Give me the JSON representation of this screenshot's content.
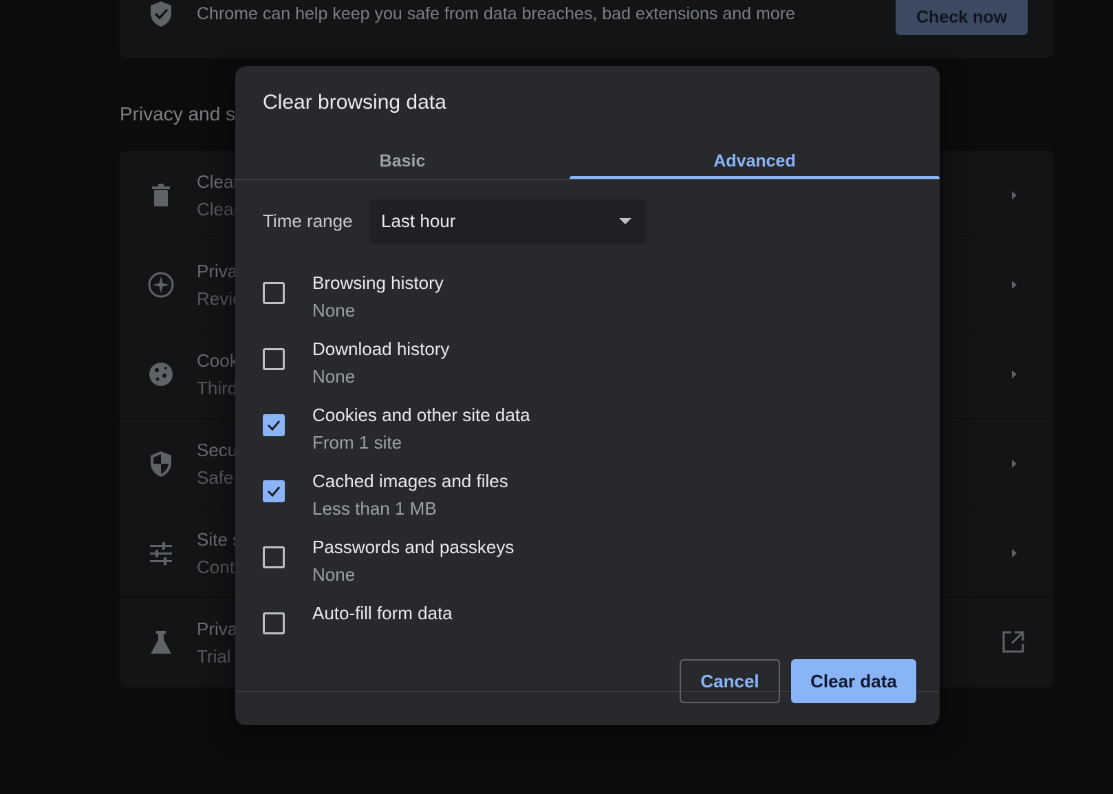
{
  "background": {
    "safety_check": {
      "text": "Chrome can help keep you safe from data breaches, bad extensions and more",
      "button_label": "Check now"
    },
    "section_heading": "Privacy and s",
    "rows": [
      {
        "title": "Clear",
        "subtitle": "Clear",
        "icon": "trash-icon",
        "action": "arrow"
      },
      {
        "title": "Priva",
        "subtitle": "Revie",
        "icon": "compass-icon",
        "action": "arrow"
      },
      {
        "title": "Cook",
        "subtitle": "Third",
        "icon": "cookie-icon",
        "action": "arrow"
      },
      {
        "title": "Secu",
        "subtitle": "Safe",
        "icon": "shield-icon",
        "action": "arrow"
      },
      {
        "title": "Site s",
        "subtitle": "Cont",
        "icon": "tune-icon",
        "action": "arrow"
      },
      {
        "title": "Priva",
        "subtitle": "Trial",
        "icon": "flask-icon",
        "action": "external-link"
      }
    ]
  },
  "dialog": {
    "title": "Clear browsing data",
    "tabs": [
      {
        "label": "Basic",
        "selected": false
      },
      {
        "label": "Advanced",
        "selected": true
      }
    ],
    "time_range": {
      "label": "Time range",
      "value": "Last hour"
    },
    "options": [
      {
        "title": "Browsing history",
        "subtitle": "None",
        "checked": false
      },
      {
        "title": "Download history",
        "subtitle": "None",
        "checked": false
      },
      {
        "title": "Cookies and other site data",
        "subtitle": "From 1 site",
        "checked": true
      },
      {
        "title": "Cached images and files",
        "subtitle": "Less than 1 MB",
        "checked": true
      },
      {
        "title": "Passwords and passkeys",
        "subtitle": "None",
        "checked": false
      },
      {
        "title": "Auto-fill form data",
        "subtitle": "",
        "checked": false
      }
    ],
    "cancel_label": "Cancel",
    "confirm_label": "Clear data"
  },
  "colors": {
    "accent": "#8ab4f8",
    "dialog_bg": "#28292c",
    "page_bg": "#0c0c0d"
  }
}
